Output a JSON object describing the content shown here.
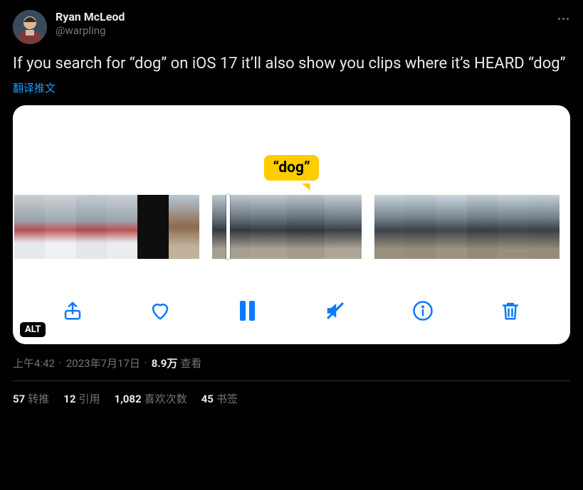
{
  "author": {
    "display_name": "Ryan McLeod",
    "handle": "@warpling"
  },
  "tweet_text": "If you search for “dog” on iOS 17 it’ll also show you clips where it’s HEARD “dog”",
  "translate_label": "翻译推文",
  "media": {
    "highlight_word": "“dog”",
    "alt_badge": "ALT",
    "toolbar": {
      "share": "share-icon",
      "like": "heart-icon",
      "pause": "pause-icon",
      "mute": "speaker-muted-icon",
      "info": "info-icon",
      "delete": "trash-icon"
    }
  },
  "meta": {
    "time": "上午4:42",
    "date": "2023年7月17日",
    "views_count": "8.9万",
    "views_label": "查看"
  },
  "stats": {
    "retweet_count": "57",
    "retweet_label": "转推",
    "quote_count": "12",
    "quote_label": "引用",
    "like_count": "1,082",
    "like_label": "喜欢次数",
    "bookmark_count": "45",
    "bookmark_label": "书签"
  }
}
